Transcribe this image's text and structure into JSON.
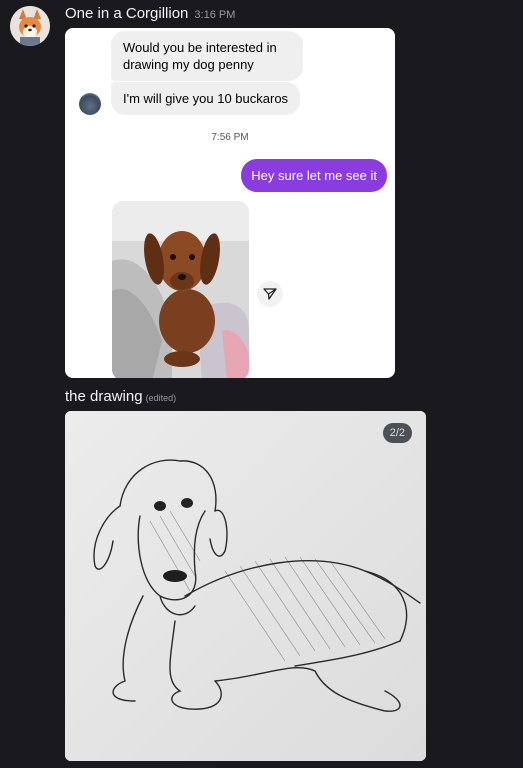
{
  "message": {
    "author": "One in a Corgillion",
    "time": "3:16 PM",
    "avatar_icon": "corgi-avatar-icon"
  },
  "screenshot_chat": {
    "incoming": [
      "Would you be interested in drawing my dog penny",
      "I'm will give you 10 buckaros"
    ],
    "time_separator": "7:56 PM",
    "outgoing": "Hey sure let me see it",
    "photo_icon": "dachshund-photo",
    "share_icon": "send-icon",
    "accent_color": "#8a3ce0"
  },
  "followup": {
    "caption": "the drawing",
    "edited": "(edited)",
    "attachment_counter": "2/2",
    "attachment_icon": "dachshund-sketch-image"
  }
}
